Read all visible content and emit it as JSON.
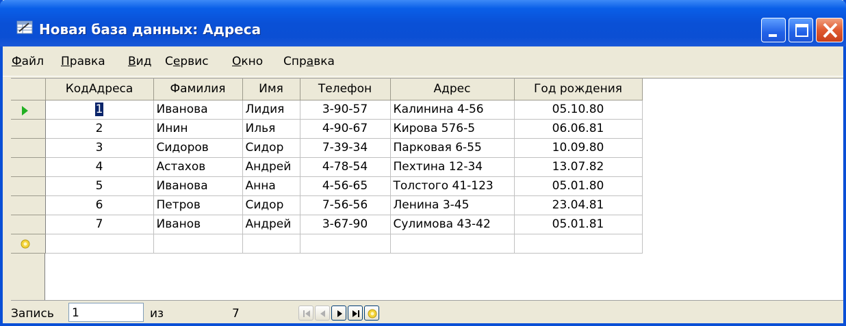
{
  "window": {
    "title": "Новая база данных: Адреса"
  },
  "menu": {
    "items": [
      {
        "accel": "Ф",
        "rest": "айл"
      },
      {
        "accel": "П",
        "rest": "равка"
      },
      {
        "accel": "В",
        "rest": "ид"
      },
      {
        "pre": "С",
        "accel": "е",
        "rest": "рвис"
      },
      {
        "accel": "О",
        "rest": "кно"
      },
      {
        "pre": "Спр",
        "accel": "а",
        "rest": "вка"
      }
    ]
  },
  "table": {
    "columns": [
      "КодАдреса",
      "Фамилия",
      "Имя",
      "Телефон",
      "Адрес",
      "Год рождения"
    ],
    "rows": [
      [
        "1",
        "Иванова",
        "Лидия",
        "3-90-57",
        "Калинина 4-56",
        "05.10.80"
      ],
      [
        "2",
        "Инин",
        "Илья",
        "4-90-67",
        "Кирова 576-5",
        "06.06.81"
      ],
      [
        "3",
        "Сидоров",
        "Сидор",
        "7-39-34",
        "Парковая 6-55",
        "10.09.80"
      ],
      [
        "4",
        "Астахов",
        "Андрей",
        "4-78-54",
        "Пехтина 12-34",
        "13.07.82"
      ],
      [
        "5",
        "Иванова",
        "Анна",
        "4-56-65",
        "Толстого 41-123",
        "05.01.80"
      ],
      [
        "6",
        "Петров",
        "Сидор",
        "7-56-56",
        "Ленина 3-45",
        "23.04.81"
      ],
      [
        "7",
        "Иванов",
        "Андрей",
        "3-67-90",
        "Сулимова 43-42",
        "05.01.81"
      ]
    ]
  },
  "navigator": {
    "label": "Запись",
    "current": "1",
    "of_label": "из",
    "total": "7"
  },
  "colors": {
    "titlebar": "#0a50d6",
    "chrome": "#ece9d8",
    "current_record_arrow": "#22b022",
    "selection": "#0a246a"
  }
}
